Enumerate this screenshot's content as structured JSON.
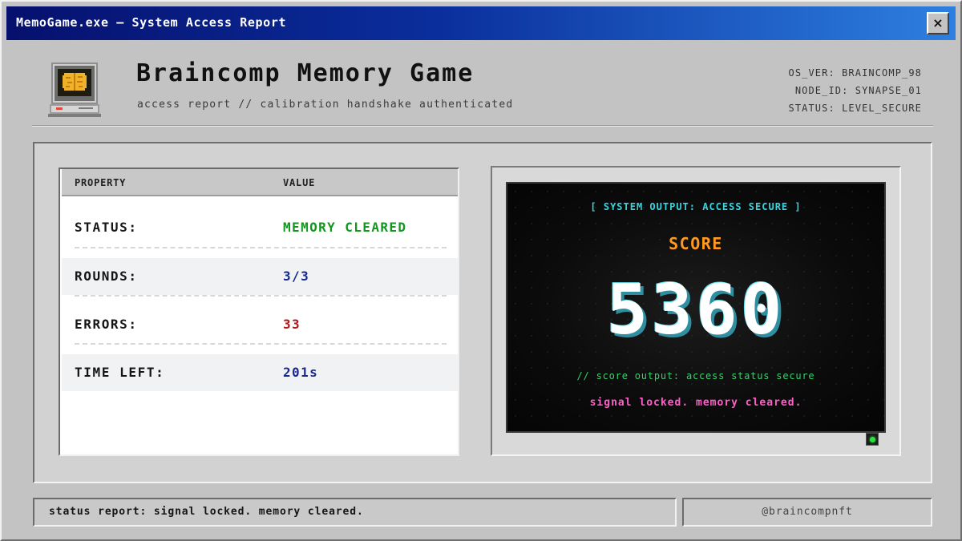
{
  "window": {
    "title": "MemoGame.exe – System Access Report",
    "close_label": "×"
  },
  "header": {
    "app_icon": "brain-computer-icon",
    "title": "Braincomp Memory Game",
    "subtitle": "access report // calibration handshake authenticated",
    "sysinfo": [
      "OS_VER: BRAINCOMP_98",
      "NODE_ID: SYNAPSE_01",
      "STATUS: LEVEL_SECURE"
    ]
  },
  "table": {
    "col_property": "PROPERTY",
    "col_value": "VALUE",
    "rows": [
      {
        "label": "STATUS:",
        "value": "MEMORY CLEARED",
        "color": "#13951f"
      },
      {
        "label": "ROUNDS:",
        "value": "3/3",
        "color": "#1a2a8c"
      },
      {
        "label": "ERRORS:",
        "value": "33",
        "color": "#b3161a"
      },
      {
        "label": "TIME LEFT:",
        "value": "201s",
        "color": "#1a2a8c"
      }
    ]
  },
  "screen": {
    "system_output": "[ SYSTEM OUTPUT: ACCESS SECURE ]",
    "score_label": "SCORE",
    "score_value": "5360",
    "score_output": "// score output: access status secure",
    "signal_message": "signal locked. memory cleared."
  },
  "status_bar": {
    "text": "status report: signal locked. memory cleared.",
    "handle": "@braincompnft"
  },
  "colors": {
    "titlebar_start": "#06106e",
    "titlebar_end": "#2d7fe0",
    "score_label": "#ff9a1f",
    "system_output": "#39d4df",
    "score_output": "#2fd46a",
    "signal_message": "#ff5fc8",
    "power_led": "#27e43b"
  }
}
